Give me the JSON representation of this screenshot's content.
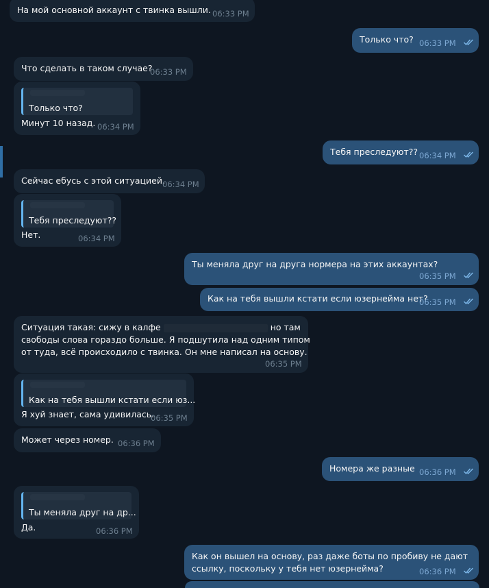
{
  "messages": [
    {
      "id": "m1",
      "text": "На мой основной аккаунт с твинка вышли.",
      "time": "06:33 PM"
    },
    {
      "id": "m2",
      "text": "Только что?",
      "time": "06:33 PM"
    },
    {
      "id": "m3",
      "text": "Что сделать в таком случае?",
      "time": "06:33 PM"
    },
    {
      "id": "m4",
      "quote": "Только что?",
      "text": "Минут 10 назад.",
      "time": "06:34 PM"
    },
    {
      "id": "m5",
      "text": "Тебя преследуют??",
      "time": "06:34 PM"
    },
    {
      "id": "m6",
      "text": "Сейчас ебусь с этой ситуацией.",
      "time": "06:34 PM"
    },
    {
      "id": "m7",
      "quote": "Тебя преследуют??",
      "text": "Нет.",
      "time": "06:34 PM"
    },
    {
      "id": "m8",
      "text": "Ты меняла друг на друга нормера на этих аккаунтах?",
      "time": "06:35 PM"
    },
    {
      "id": "m9",
      "text": "Как на тебя вышли кстати если юзернейма нет?",
      "time": "06:35 PM"
    },
    {
      "id": "m10",
      "line1a": "Ситуация такая: сижу в калфе",
      "line1b": "но там",
      "line2": "свободы слова гораздо больше. Я подшутила над одним типом",
      "line3": "от туда, всё происходило с твинка. Он мне написал на основу.",
      "time": "06:35 PM"
    },
    {
      "id": "m11",
      "quote": "Как на тебя вышли кстати если юз...",
      "text": "Я хуй знает, сама удивилась.",
      "time": "06:35 PM"
    },
    {
      "id": "m12",
      "text": "Может через номер.",
      "time": "06:36 PM"
    },
    {
      "id": "m13",
      "text": "Номера же разные",
      "time": "06:36 PM"
    },
    {
      "id": "m14",
      "quote": "Ты меняла друг на др...",
      "text": "Да.",
      "time": "06:36 PM"
    },
    {
      "id": "m15",
      "line1": "Как он вышел на основу, раз даже боты по пробиву не дают",
      "line2": "ссылку, поскольку у тебя нет юзернейма?",
      "time": "06:36 PM"
    }
  ],
  "colors": {
    "background": "#0e1621",
    "incoming": "#182533",
    "outgoing": "#2b5278",
    "accent": "#64b5ef"
  },
  "icons": {
    "read": "double-check-icon"
  }
}
